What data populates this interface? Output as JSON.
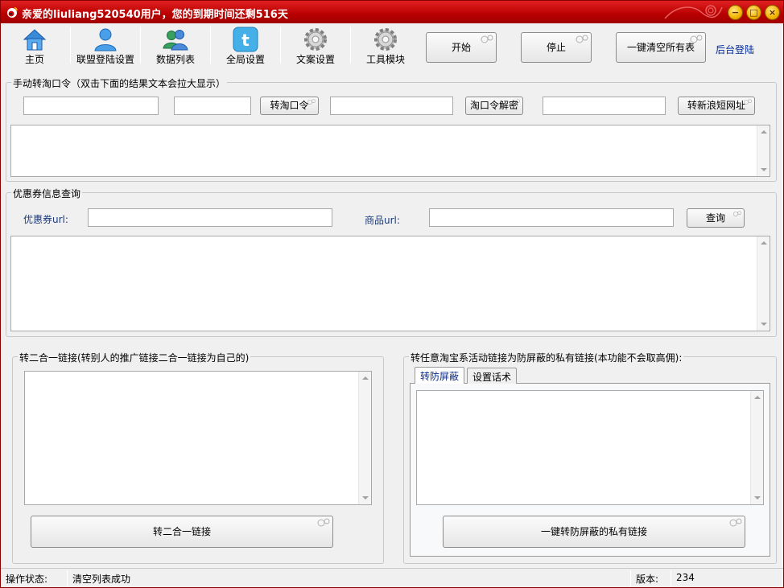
{
  "title": "亲爱的liuliang520540用户，您的到期时间还剩516天",
  "window_controls": {
    "minimize": "−",
    "maximize": "□",
    "close": "×"
  },
  "colors": {
    "titlebar": "#c00000",
    "link": "#002a9a",
    "label": "#1a3a7a"
  },
  "toolbar": {
    "items": [
      {
        "label": "主页",
        "icon": "house-icon"
      },
      {
        "label": "联盟登陆设置",
        "icon": "user-icon"
      },
      {
        "label": "数据列表",
        "icon": "users-icon"
      },
      {
        "label": "全局设置",
        "icon": "twitter-bird-icon"
      },
      {
        "label": "文案设置",
        "icon": "gear-icon"
      },
      {
        "label": "工具模块",
        "icon": "gear-icon"
      }
    ],
    "start": "开始",
    "stop": "停止",
    "clear_all": "一键清空所有表",
    "backend_login": "后台登陆"
  },
  "taokouling_group": {
    "title": "手动转淘口令（双击下面的结果文本会拉大显示）",
    "input1": "",
    "input2": "",
    "convert_button": "转淘口令",
    "input3": "",
    "decode_button": "淘口令解密",
    "input4": "",
    "sina_button": "转新浪短网址",
    "result": ""
  },
  "coupon_group": {
    "title": "优惠券信息查询",
    "coupon_url_label": "优惠券url:",
    "coupon_url": "",
    "product_url_label": "商品url:",
    "product_url": "",
    "query_button": "查询",
    "result": ""
  },
  "two_in_one_group": {
    "title": "转二合一链接(转别人的推广链接二合一链接为自己的)",
    "text": "",
    "convert_button": "转二合一链接"
  },
  "private_link_group": {
    "title": "转任意淘宝系活动链接为防屏蔽的私有链接(本功能不会取高佣):",
    "tabs": [
      "转防屏蔽",
      "设置话术"
    ],
    "text": "",
    "convert_button": "一键转防屏蔽的私有链接"
  },
  "status": {
    "label": "操作状态:",
    "value": "清空列表成功",
    "version_label": "版本:",
    "version": "234"
  }
}
